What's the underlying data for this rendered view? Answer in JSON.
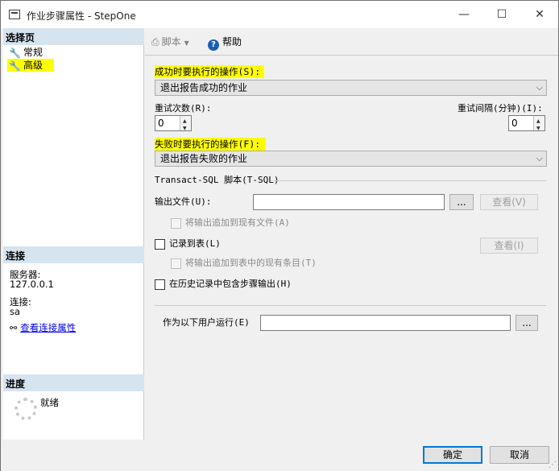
{
  "window": {
    "title": "作业步骤属性 - StepOne",
    "minimize": "—",
    "maximize": "☐",
    "close": "✕"
  },
  "left": {
    "select_page_header": "选择页",
    "pages": [
      {
        "label": "常规",
        "icon": "wrench-icon",
        "highlighted": false
      },
      {
        "label": "高级",
        "icon": "wrench-icon",
        "highlighted": true
      }
    ],
    "connection_header": "连接",
    "server_label": "服务器:",
    "server_value": "127.0.0.1",
    "connection_label": "连接:",
    "connection_value": "sa",
    "view_connection_link": "查看连接属性",
    "progress_header": "进度",
    "progress_status": "就绪"
  },
  "toolbar": {
    "script_label": "脚本",
    "help_label": "帮助"
  },
  "main": {
    "on_success_label": "成功时要执行的操作(S):",
    "on_success_value": "退出报告成功的作业",
    "retry_attempts_label": "重试次数(R):",
    "retry_attempts_value": "0",
    "retry_interval_label": "重试间隔(分钟)(I):",
    "retry_interval_value": "0",
    "on_failure_label": "失败时要执行的操作(F):",
    "on_failure_value": "退出报告失败的作业",
    "tsql_section": "Transact-SQL 脚本(T-SQL)",
    "output_file_label": "输出文件(U):",
    "output_file_value": "",
    "browse_button": "...",
    "view_button_1": "查看(V)",
    "append_output_label": "将输出追加到现有文件(A)",
    "log_to_table_label": "记录到表(L)",
    "view_button_2": "查看(I)",
    "append_table_label": "将输出追加到表中的现有条目(T)",
    "include_history_label": "在历史记录中包含步骤输出(H)",
    "run_as_label": "作为以下用户运行(E)",
    "run_as_value": "",
    "run_as_browse": "..."
  },
  "footer": {
    "ok_button": "确定",
    "cancel_button": "取消"
  },
  "colors": {
    "highlight": "#ffff00",
    "section_header": "#d6e4f0",
    "link": "#0000ee",
    "accent": "#0078d7"
  }
}
